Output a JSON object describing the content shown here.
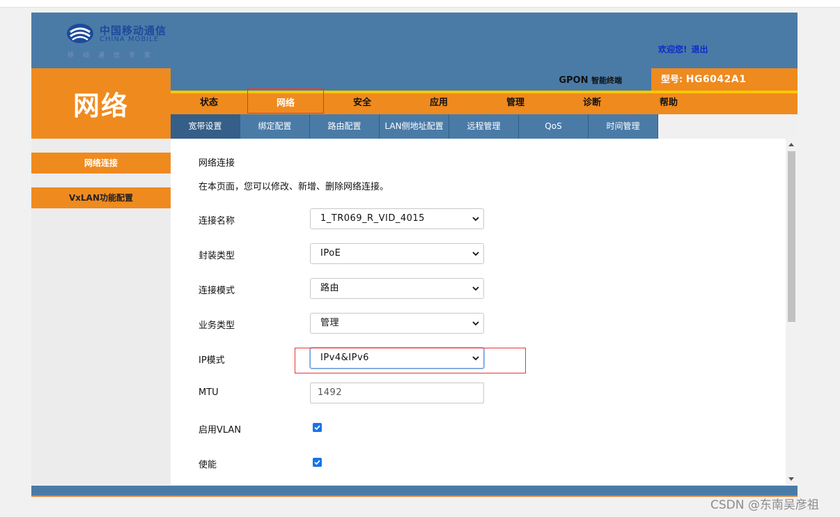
{
  "header": {
    "logo_cn": "中国移动通信",
    "logo_en": "CHINA MOBILE",
    "logo_slogan": "移动通信专家",
    "welcome_text": "欢迎您!",
    "logout_label": "退出",
    "brand_color": "#4a7ba7",
    "accent_color": "#ef8a1e"
  },
  "section_title": "网络",
  "product": {
    "name": "GPON",
    "type": "智能终端",
    "model_label": "型号:",
    "model_value": "HG6042A1"
  },
  "main_nav": {
    "items": [
      {
        "label": "状态"
      },
      {
        "label": "网络",
        "active": true
      },
      {
        "label": "安全"
      },
      {
        "label": "应用"
      },
      {
        "label": "管理"
      },
      {
        "label": "诊断"
      },
      {
        "label": "帮助"
      }
    ]
  },
  "sub_nav": {
    "items": [
      {
        "label": "宽带设置",
        "active": true
      },
      {
        "label": "绑定配置"
      },
      {
        "label": "路由配置"
      },
      {
        "label": "LAN侧地址配置"
      },
      {
        "label": "远程管理"
      },
      {
        "label": "QoS"
      },
      {
        "label": "时间管理"
      }
    ]
  },
  "left_menu": {
    "items": [
      {
        "label": "网络连接",
        "active": true
      },
      {
        "label": "VxLAN功能配置"
      }
    ]
  },
  "main": {
    "title": "网络连接",
    "description": "在本页面，您可以修改、新增、删除网络连接。",
    "fields": {
      "connection_name": {
        "label": "连接名称",
        "value": "1_TR069_R_VID_4015"
      },
      "encap_type": {
        "label": "封装类型",
        "value": "IPoE"
      },
      "connection_mode": {
        "label": "连接模式",
        "value": "路由"
      },
      "service_type": {
        "label": "业务类型",
        "value": "管理"
      },
      "ip_mode": {
        "label": "IP模式",
        "value": "IPv4&IPv6"
      },
      "mtu": {
        "label": "MTU",
        "placeholder": "1492"
      },
      "enable_vlan": {
        "label": "启用VLAN",
        "checked": true
      },
      "enable": {
        "label": "使能",
        "checked": true
      }
    }
  },
  "watermark": "CSDN @东南吴彦祖"
}
